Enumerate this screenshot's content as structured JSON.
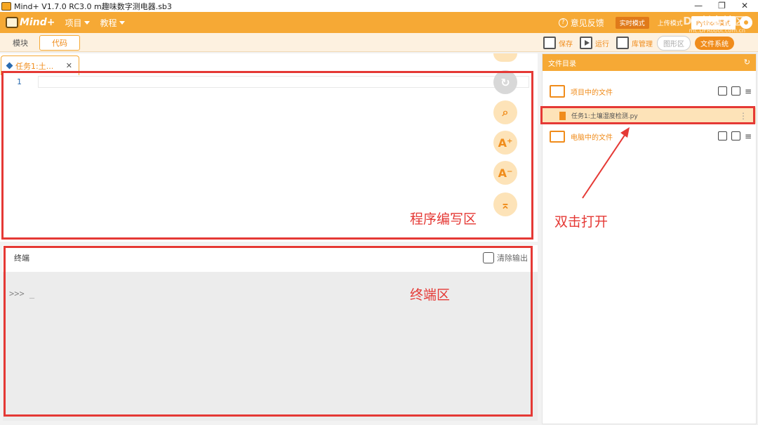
{
  "window": {
    "title": "Mind+ V1.7.0 RC3.0   m趣味数字测电器.sb3",
    "controls": [
      "—",
      "❐",
      "✕"
    ]
  },
  "menubar": {
    "logo": "Mind+",
    "menus": [
      {
        "label": "项目"
      },
      {
        "label": "教程"
      }
    ],
    "feedback": "意见反馈",
    "modes": {
      "realtime": "实时模式",
      "upload": "上传模式",
      "python": "Python模式"
    },
    "watermark": "DF创客社区",
    "watermark_url": "mc.DFRobot.com.cn"
  },
  "tabs": {
    "blocks": "模块",
    "code": "代码"
  },
  "toolbar": {
    "save": "保存",
    "run": "运行",
    "library": "库管理",
    "grid": "图形区",
    "filesystem": "文件系统"
  },
  "editor": {
    "file_tab": "任务1:土...",
    "close": "✕",
    "line_numbers": [
      "1"
    ],
    "fab_icons": [
      "undo-icon",
      "redo-icon",
      "search-icon",
      "zoom-in-icon",
      "zoom-out-icon",
      "collapse-icon"
    ]
  },
  "terminal": {
    "title": "终端",
    "clear": "清除输出",
    "prompt": ">>> _"
  },
  "filepanel": {
    "title": "文件目录",
    "project_files": "项目中的文件",
    "file_name": "任务1:土壤湿度检测.py",
    "computer_files": "电脑中的文件"
  },
  "annotations": {
    "editor_area": "程序编写区",
    "terminal_area": "终端区",
    "double_click": "双击打开",
    "color": "#e53935"
  }
}
